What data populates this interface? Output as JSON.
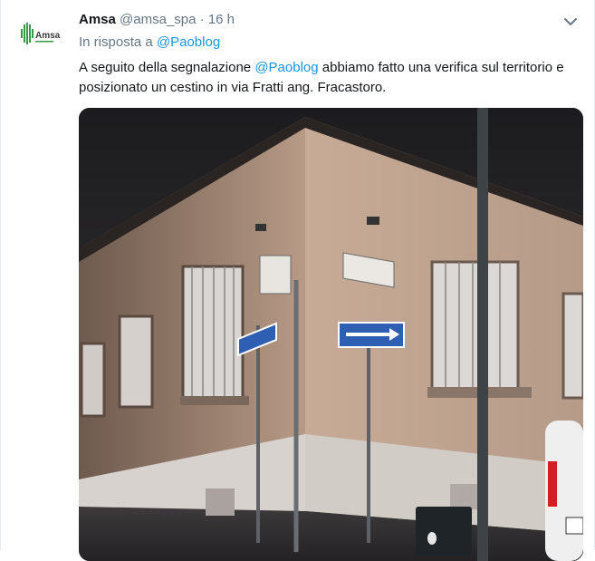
{
  "tweet": {
    "avatar_logo_text": "Amsa",
    "name": "Amsa",
    "handle": "@amsa_spa",
    "separator": "·",
    "time": "16 h",
    "reply_prefix": "In risposta a",
    "reply_to": "@Paoblog",
    "text_before": "A seguito della segnalazione ",
    "text_mention": "@Paoblog",
    "text_after": " abbiamo fatto una verifica sul territorio e posizionato un cestino in via Fratti ang. Fracastoro.",
    "menu_icon": "chevron-down-icon",
    "colors": {
      "link": "#1b95e0",
      "secondary": "#657786",
      "brand_green": "#3a9b46"
    }
  }
}
